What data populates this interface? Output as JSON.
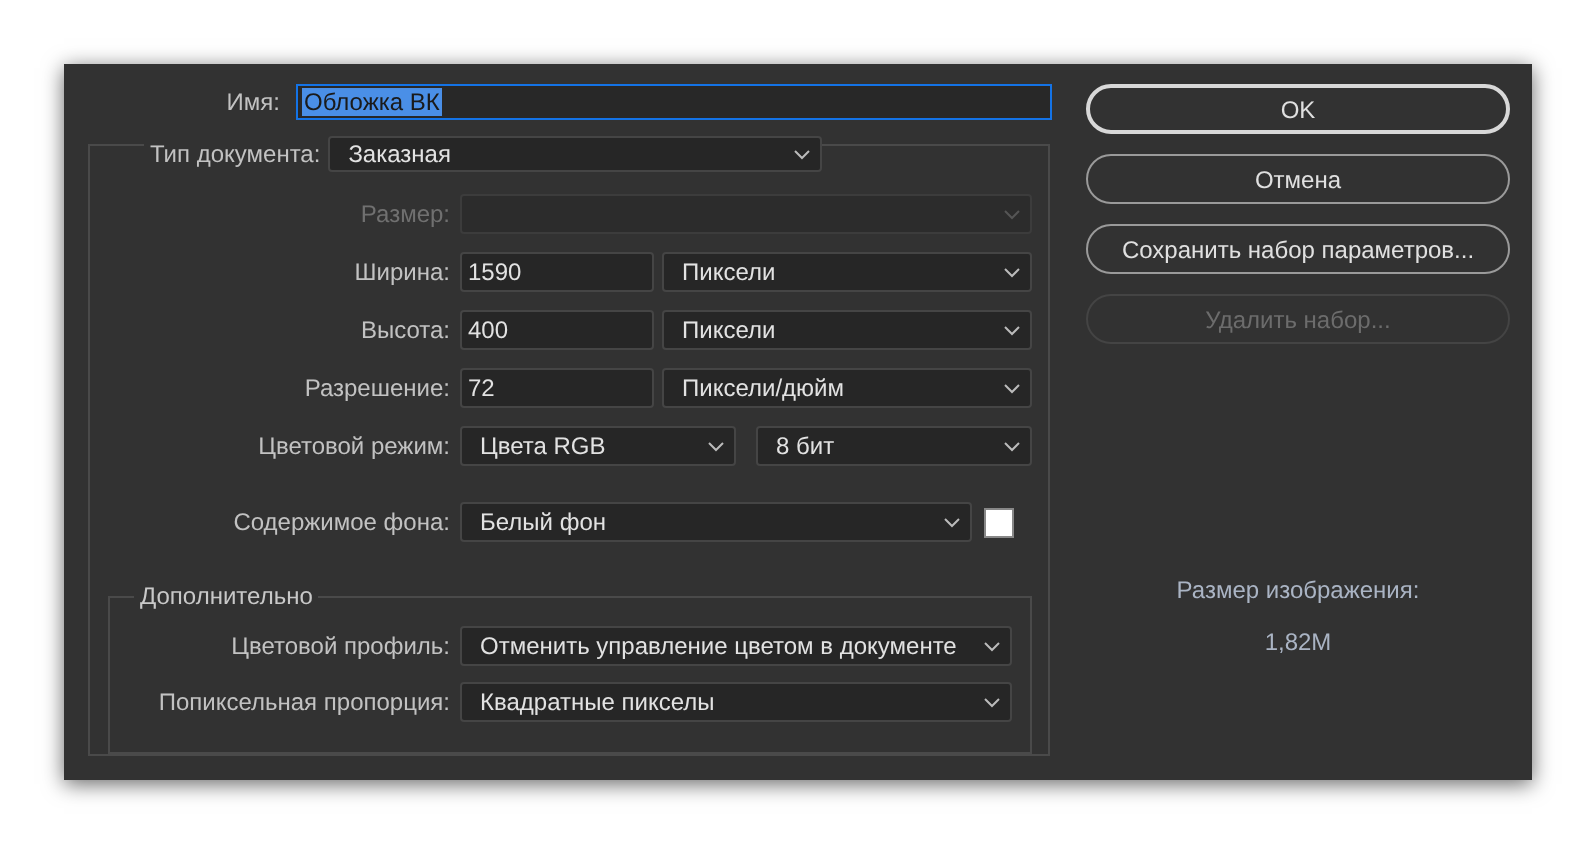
{
  "name": {
    "label": "Имя:",
    "value": "Обложка ВК",
    "text_selected": true
  },
  "document_type": {
    "label": "Тип документа:",
    "value": "Заказная"
  },
  "rows": [
    {
      "label": "Размер:",
      "disabled": true,
      "controls": [
        {
          "kind": "select",
          "disabled": true
        }
      ]
    },
    {
      "label": "Ширина:",
      "disabled": false,
      "controls": [
        {
          "kind": "input",
          "value": "1590"
        },
        {
          "kind": "select",
          "value": "Пиксели"
        }
      ]
    },
    {
      "label": "Высота:",
      "disabled": false,
      "controls": [
        {
          "kind": "input",
          "value": "400"
        },
        {
          "kind": "select",
          "value": "Пиксели"
        }
      ]
    },
    {
      "label": "Разрешение:",
      "disabled": false,
      "controls": [
        {
          "kind": "input",
          "value": "72"
        },
        {
          "kind": "select",
          "value": "Пиксели/дюйм"
        }
      ]
    },
    {
      "label": "Цветовой режим:",
      "disabled": false,
      "controls": [
        {
          "kind": "select",
          "value": "Цвета RGB"
        },
        {
          "kind": "select",
          "value": "8 бит"
        }
      ]
    },
    {
      "label": "Содержимое фона:",
      "disabled": false,
      "controls": [
        {
          "kind": "select",
          "value": "Белый фон"
        },
        {
          "kind": "swatch",
          "color": "#ffffff"
        }
      ]
    }
  ],
  "advanced": {
    "title": "Дополнительно",
    "rows": [
      {
        "label": "Цветовой профиль:",
        "value": "Отменить управление цветом в документе"
      },
      {
        "label": "Попиксельная пропорция:",
        "value": "Квадратные пикселы"
      }
    ]
  },
  "buttons": [
    {
      "label": "OK",
      "default": true,
      "disabled": false
    },
    {
      "label": "Отмена",
      "default": false,
      "disabled": false
    },
    {
      "label": "Сохранить набор параметров...",
      "default": false,
      "disabled": false
    },
    {
      "label": "Удалить набор...",
      "default": false,
      "disabled": true
    }
  ],
  "image_size": {
    "label": "Размер изображения:",
    "value": "1,82M"
  }
}
